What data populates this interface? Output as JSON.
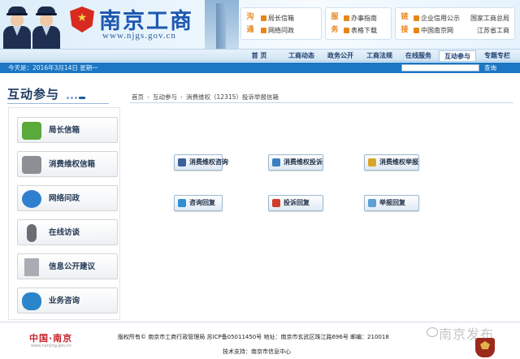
{
  "header": {
    "site_title": "南京工商",
    "site_url": "www.njgs.gov.cn",
    "boxes": [
      {
        "tag": "沟通",
        "links": [
          "局长信箱",
          "网络问政"
        ]
      },
      {
        "tag": "服务",
        "links": [
          "办事指南",
          "表格下载"
        ]
      },
      {
        "tag": "链接",
        "links": [
          "企业信用公示",
          "国家工商总局",
          "中国南京网",
          "江苏省工商"
        ]
      }
    ]
  },
  "nav": {
    "items": [
      "首 页",
      "工商动态",
      "政务公开",
      "工商法规",
      "在线服务",
      "互动参与",
      "专题专栏"
    ],
    "active_index": 5
  },
  "datebar": {
    "date": "今天是：2016年3月14日 星期一",
    "search_placeholder": "",
    "search_label": "查询"
  },
  "sidebar": {
    "title": "互动参与",
    "items": [
      {
        "label": "局长信箱",
        "icon": "envelope-icon",
        "color": "#5aa93a"
      },
      {
        "label": "消费维权信箱",
        "icon": "mail-icon",
        "color": "#8c8f93"
      },
      {
        "label": "网络问政",
        "icon": "globe-icon",
        "color": "#2f7fd0"
      },
      {
        "label": "在线访谈",
        "icon": "microphone-icon",
        "color": "#6a6d72"
      },
      {
        "label": "信息公开建议",
        "icon": "document-icon",
        "color": "#a9adb3"
      },
      {
        "label": "业务咨询",
        "icon": "chat-icon",
        "color": "#2a86c9"
      }
    ]
  },
  "breadcrumb": [
    "首页",
    "互动参与",
    "消费维权（12315）投诉举报信箱"
  ],
  "actions": [
    {
      "label": "消费维权咨询",
      "icon": "consult-icon",
      "color": "#3d5f9c"
    },
    {
      "label": "消费维权投诉",
      "icon": "complaint-icon",
      "color": "#3a7fc2"
    },
    {
      "label": "消费维权举报",
      "icon": "report-icon",
      "color": "#d9a62a"
    },
    {
      "label": "咨询回复",
      "icon": "reply-consult-icon",
      "color": "#2f8fd3"
    },
    {
      "label": "投诉回复",
      "icon": "reply-complaint-icon",
      "color": "#d23b2b"
    },
    {
      "label": "举报回复",
      "icon": "reply-report-icon",
      "color": "#5b9fd6"
    }
  ],
  "footer": {
    "logo": "中国·南京",
    "logo_sub": "www.nanjing.gov.cn",
    "copyright": "版权所有© 南京市工商行政管理局  苏ICP备05011450号  地址：南京市玄武区珠江路696号  邮编：210018",
    "support": "技术支持：南京市信息中心",
    "watermark": "南京发布"
  }
}
